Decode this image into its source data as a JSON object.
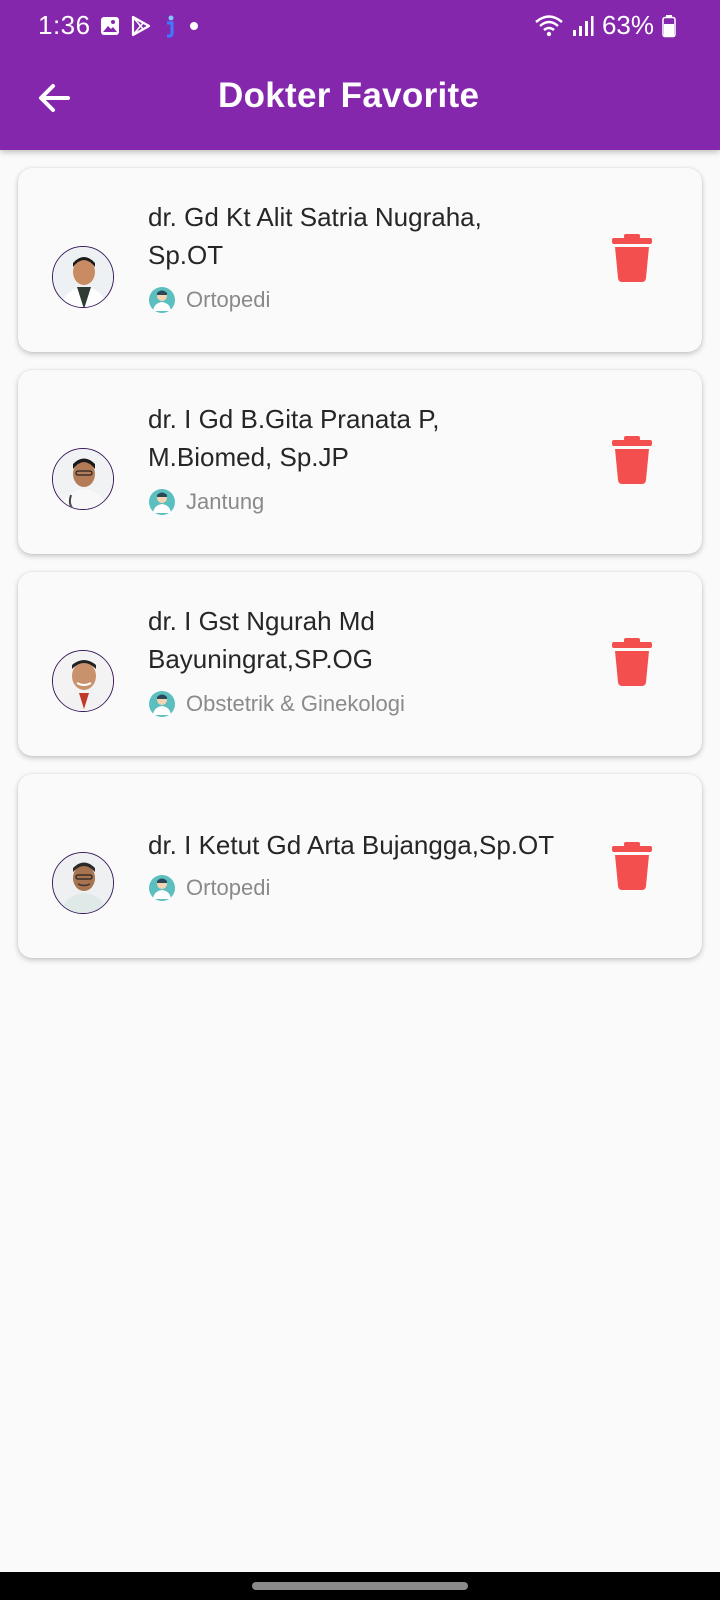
{
  "status_bar": {
    "time": "1:36",
    "battery": "63%",
    "icons": [
      "gallery-icon",
      "play-store-icon",
      "app-notification-icon",
      "dot-icon",
      "wifi-icon",
      "signal-icon",
      "battery-icon"
    ]
  },
  "header": {
    "title": "Dokter Favorite",
    "back_icon": "arrow-left-icon"
  },
  "doctors": [
    {
      "name_line1": "dr. Gd Kt Alit Satria Nugraha,",
      "name_line2": "Sp.OT",
      "specialty": "Ortopedi"
    },
    {
      "name_line1": "dr. I Gd B.Gita Pranata P,",
      "name_line2": "M.Biomed, Sp.JP",
      "specialty": "Jantung"
    },
    {
      "name_line1": "dr. I Gst Ngurah Md",
      "name_line2": "Bayuningrat,SP.OG",
      "specialty": "Obstetrik & Ginekologi"
    },
    {
      "name_line1": "dr. I Ketut Gd Arta Bujangga,Sp.OT",
      "name_line2": "",
      "specialty": "Ortopedi"
    }
  ],
  "colors": {
    "appbar": "#8527ad",
    "delete": "#f44f4f",
    "specialty_icon": "#5bbfc0",
    "background": "#fafafa"
  }
}
